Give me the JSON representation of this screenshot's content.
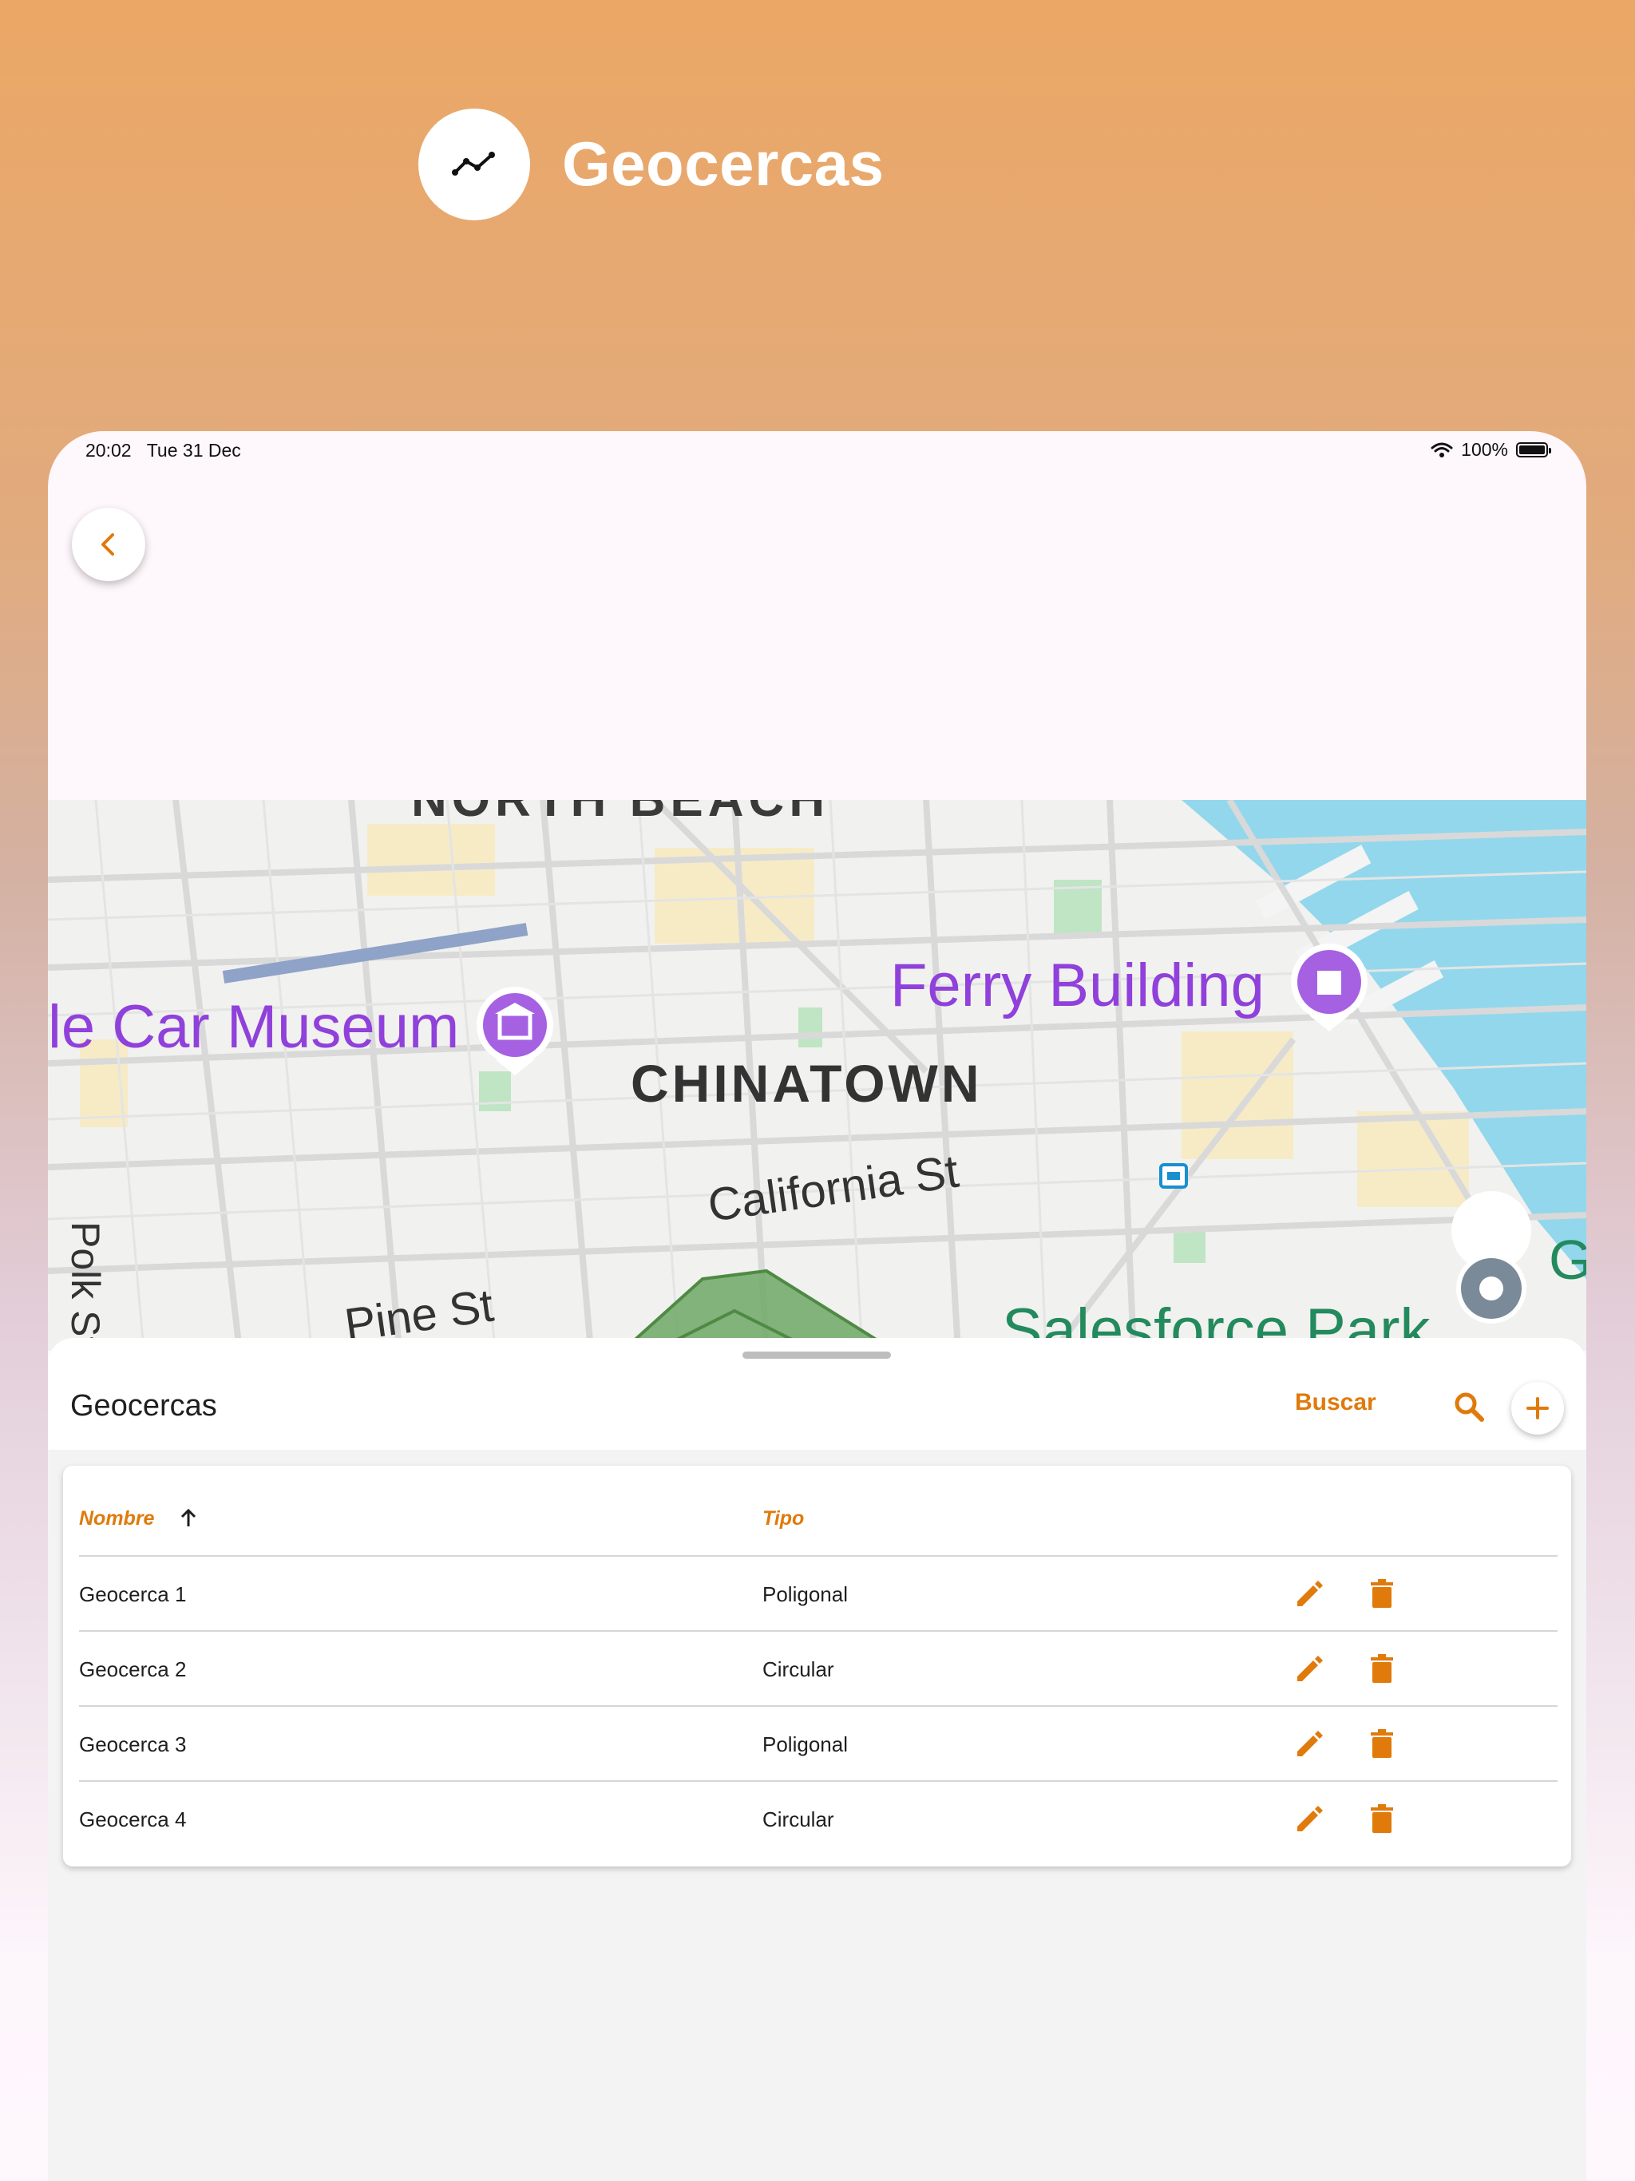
{
  "header": {
    "title": "Geocercas",
    "icon": "trend-line-icon"
  },
  "status_bar": {
    "time": "20:02",
    "date": "Tue 31 Dec",
    "battery": "100%"
  },
  "map": {
    "labels": {
      "north_beach": "NORTH BEACH",
      "car_museum": "le Car Museum",
      "ferry_building": "Ferry Building",
      "chinatown": "CHINATOWN",
      "california_st": "California St",
      "pine_st": "Pine St",
      "polk_st": "Polk St",
      "salesforce_park": "Salesforce Park",
      "partial_letter": "G"
    }
  },
  "sheet": {
    "title": "Geocercas",
    "search_label": "Buscar",
    "accent_color": "#E07A0B"
  },
  "table": {
    "columns": [
      "Nombre",
      "Tipo"
    ],
    "rows": [
      {
        "name": "Geocerca 1",
        "type": "Poligonal"
      },
      {
        "name": "Geocerca 2",
        "type": "Circular"
      },
      {
        "name": "Geocerca 3",
        "type": "Poligonal"
      },
      {
        "name": "Geocerca 4",
        "type": "Circular"
      }
    ]
  }
}
